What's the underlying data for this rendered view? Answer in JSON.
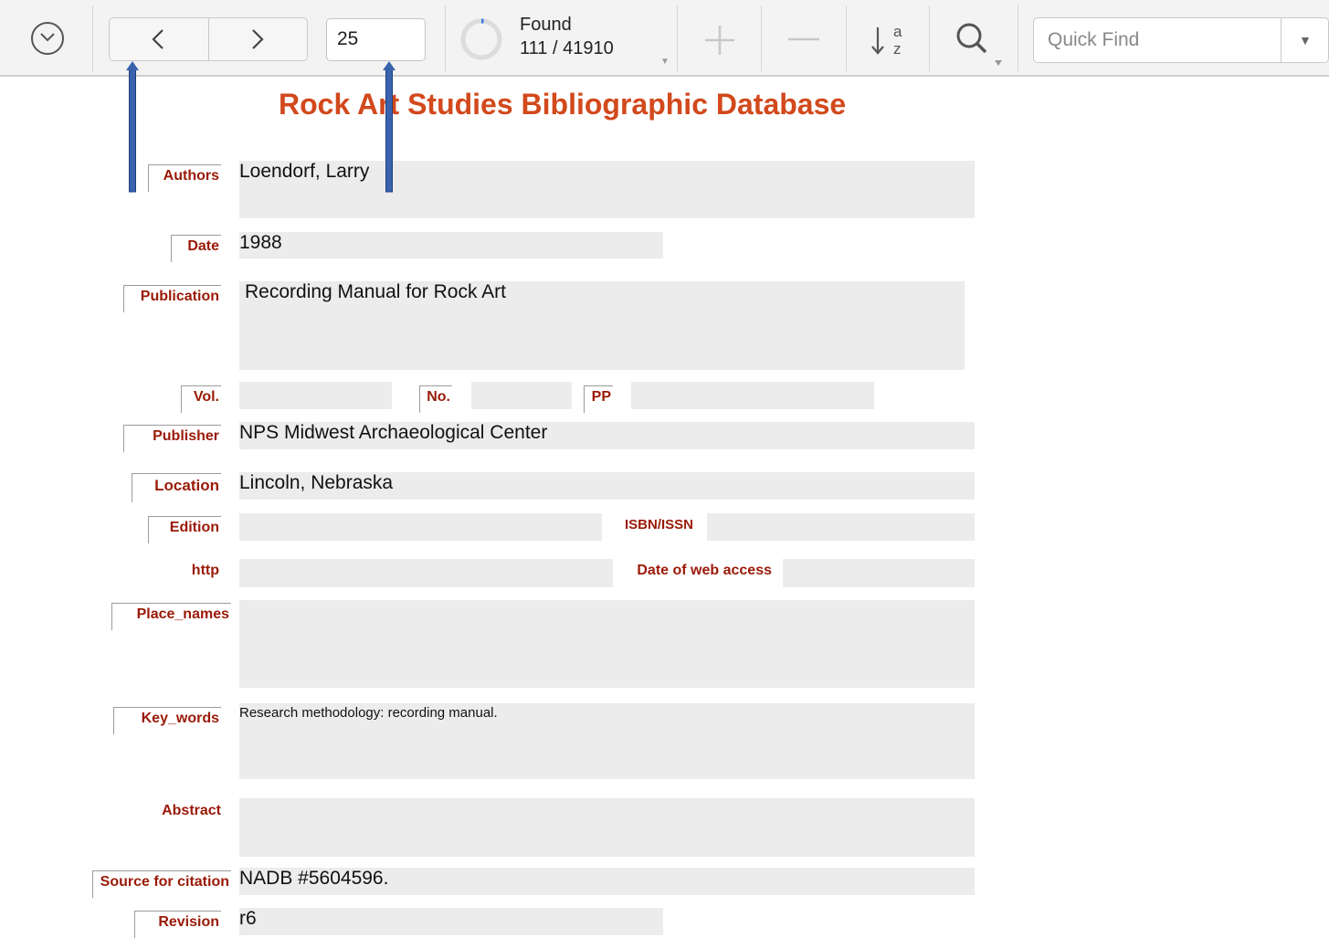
{
  "toolbar": {
    "record_number": "25",
    "found_label": "Found",
    "found_count": "111 / 41910",
    "quick_find_placeholder": "Quick Find"
  },
  "form": {
    "title": "Rock Art Studies Bibliographic Database",
    "labels": {
      "authors": "Authors",
      "date": "Date",
      "publication": "Publication",
      "vol": "Vol.",
      "no": "No.",
      "pp": "PP",
      "publisher": "Publisher",
      "location": "Location",
      "edition": "Edition",
      "isbn": "ISBN/ISSN",
      "http": "http",
      "web_access": "Date of web access",
      "place_names": "Place_names",
      "key_words": "Key_words",
      "abstract": "Abstract",
      "source": "Source for citation",
      "revision": "Revision"
    },
    "values": {
      "authors": "Loendorf, Larry",
      "date": "1988",
      "publication": "Recording Manual for Rock Art",
      "vol": "",
      "no": "",
      "pp": "",
      "publisher": "NPS Midwest Archaeological Center",
      "location": "Lincoln, Nebraska",
      "edition": "",
      "isbn": "",
      "http": "",
      "web_access": "",
      "place_names": "",
      "key_words": "Research methodology: recording manual.",
      "abstract": "",
      "source": "NADB #5604596.",
      "revision": "r6"
    }
  },
  "colors": {
    "title": "#d2491c",
    "label": "#9a1a08",
    "field_bg": "#ececec",
    "annotation_arrow": "#3a63ae"
  }
}
